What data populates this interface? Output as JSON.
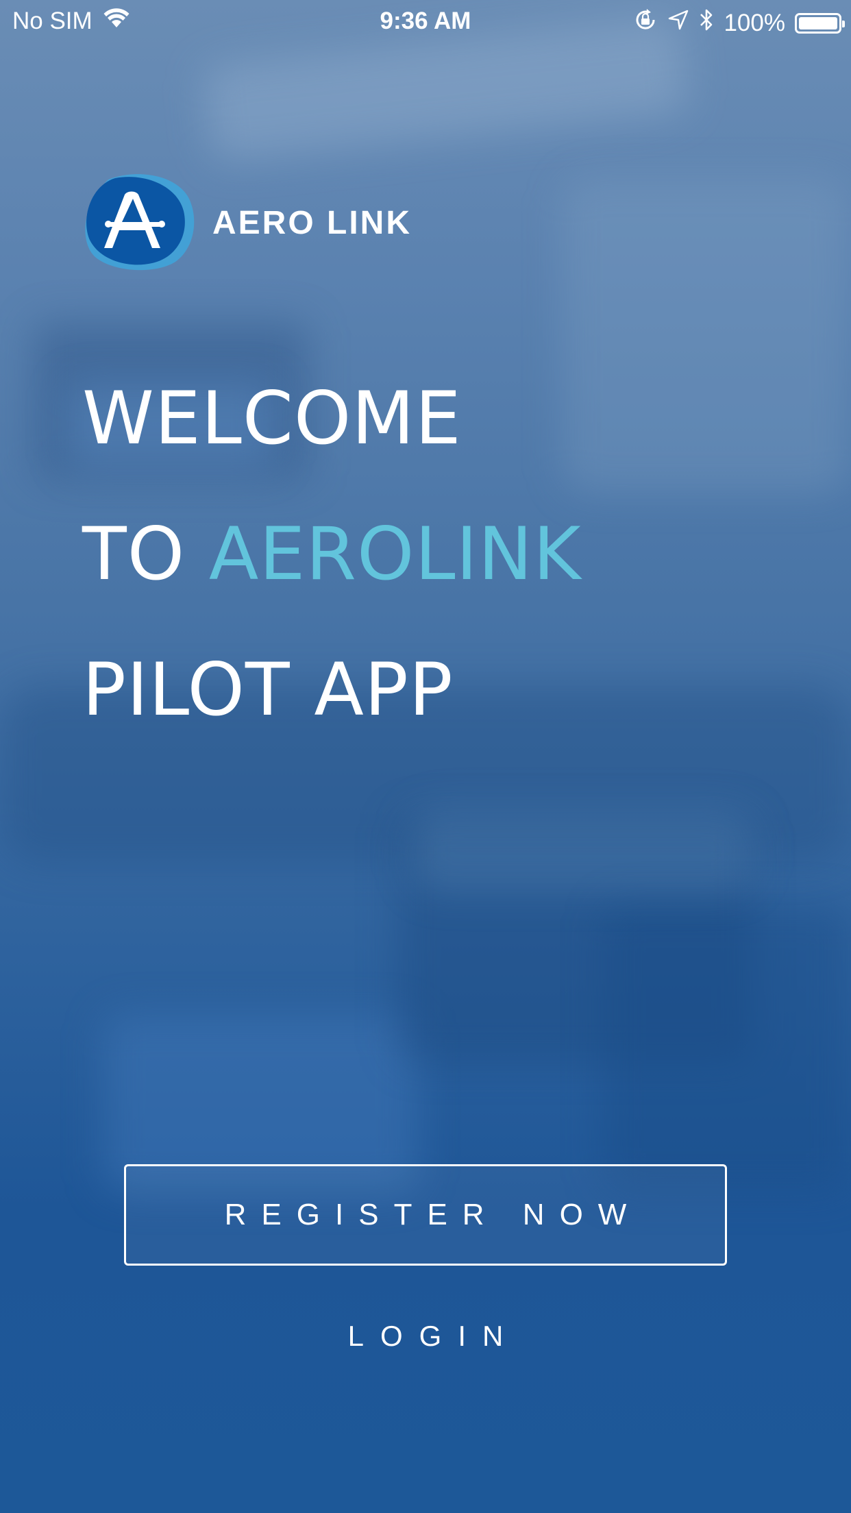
{
  "status_bar": {
    "carrier": "No SIM",
    "time": "9:36 AM",
    "battery_percent": "100%",
    "battery_level": 1.0,
    "icons": [
      "wifi-icon",
      "orientation-lock-icon",
      "location-arrow-icon",
      "bluetooth-icon",
      "battery-icon"
    ]
  },
  "brand": {
    "logo_name": "AERO LINK",
    "accent_color": "#62c4dc",
    "logo_colors": [
      "#0b56a4",
      "#3ea6dc"
    ]
  },
  "welcome": {
    "line1": "WELCOME",
    "line2_prefix": "TO",
    "line2_accent": "AEROLINK",
    "line3": "PILOT APP"
  },
  "actions": {
    "register_label": "REGISTER NOW",
    "login_label": "LOGIN"
  }
}
